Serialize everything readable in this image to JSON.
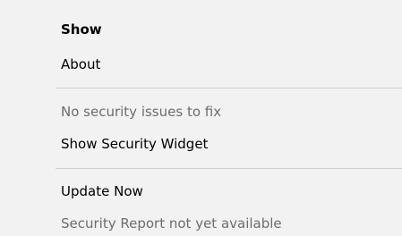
{
  "menu": {
    "items": [
      {
        "label": "Show"
      },
      {
        "label": "About"
      },
      {
        "label": "No security issues to fix"
      },
      {
        "label": "Show Security Widget"
      },
      {
        "label": "Update Now"
      },
      {
        "label": "Security Report not yet available"
      }
    ]
  }
}
